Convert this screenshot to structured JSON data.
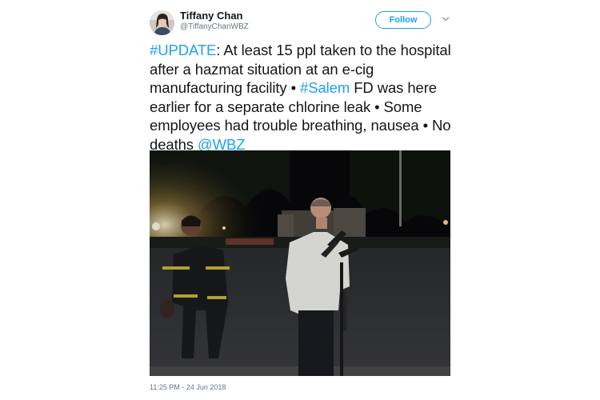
{
  "author": {
    "display_name": "Tiffany Chan",
    "handle": "@TiffanyChanWBZ"
  },
  "actions": {
    "follow_label": "Follow",
    "menu_icon": "chevron-down-icon"
  },
  "tweet": {
    "segments": [
      {
        "text": "#UPDATE",
        "type": "hashtag"
      },
      {
        "text": ": At least 15 ppl taken to the hospital after a hazmat situation at an e-cig manufacturing facility • ",
        "type": "text"
      },
      {
        "text": "#Salem",
        "type": "hashtag"
      },
      {
        "text": " FD was here earlier for a separate chlorine leak • Some employees had trouble breathing, nausea • No deaths ",
        "type": "text"
      },
      {
        "text": "@WBZ",
        "type": "mention"
      }
    ],
    "timestamp": "11:25 PM - 24 Jun 2018"
  },
  "colors": {
    "link": "#1da1f2",
    "text": "#14171a",
    "muted": "#657786"
  }
}
